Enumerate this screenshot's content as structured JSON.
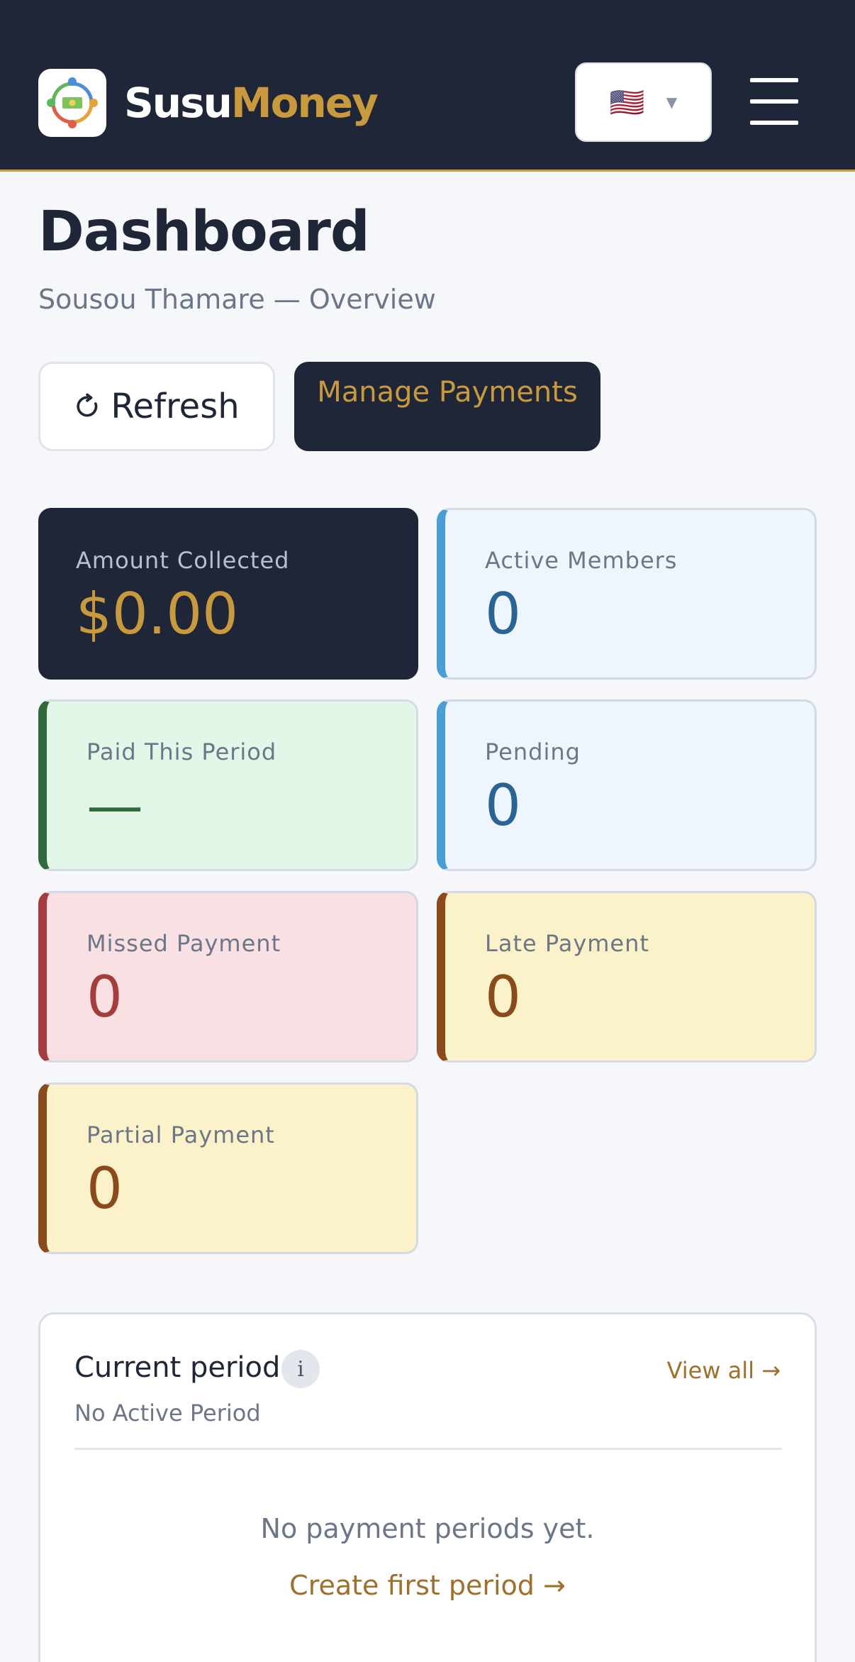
{
  "header": {
    "brand_part1": "Susu",
    "brand_part2": "Money",
    "language_flag": "🇺🇸",
    "language_caret": "▼",
    "colors": {
      "bar": "#1f2637",
      "accent": "#c99a3b"
    }
  },
  "page": {
    "title": "Dashboard",
    "subtitle": "Sousou Thamare — Overview",
    "refresh_label": "Refresh",
    "manage_label": "Manage Payments"
  },
  "stats": {
    "amount_collected": {
      "label": "Amount Collected",
      "value": "$0.00"
    },
    "active_members": {
      "label": "Active Members",
      "value": "0"
    },
    "paid_this_period": {
      "label": "Paid This Period",
      "value": "—"
    },
    "pending": {
      "label": "Pending",
      "value": "0"
    },
    "missed_payment": {
      "label": "Missed Payment",
      "value": "0"
    },
    "late_payment": {
      "label": "Late Payment",
      "value": "0"
    },
    "partial_payment": {
      "label": "Partial Payment",
      "value": "0"
    }
  },
  "current_period": {
    "title": "Current period",
    "info_glyph": "i",
    "view_all": "View all →",
    "status": "No Active Period",
    "empty_message": "No payment periods yet.",
    "create_link": "Create first period →"
  }
}
